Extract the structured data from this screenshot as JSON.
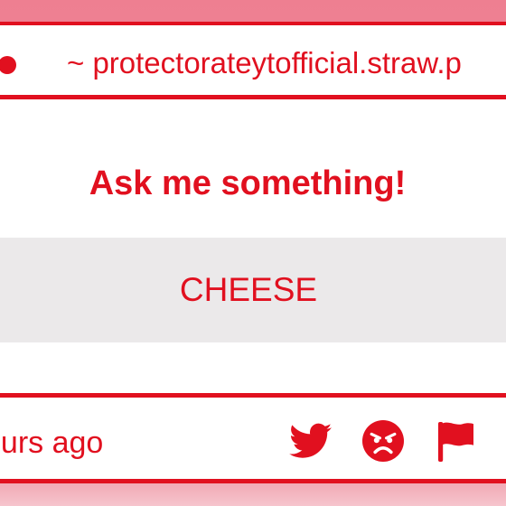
{
  "browser": {
    "url": "~ protectorateytofficial.straw.p"
  },
  "card": {
    "heading": "Ask me something!",
    "answer": "CHEESE"
  },
  "footer": {
    "time": "ours ago"
  },
  "icons": [
    "twitter-icon",
    "angry-face-icon",
    "flag-icon"
  ],
  "colors": {
    "accent": "#e1101f",
    "answer_background": "#ebe9ea",
    "top_band": "#ee8092",
    "bottom_band": "#f1a9b5"
  }
}
